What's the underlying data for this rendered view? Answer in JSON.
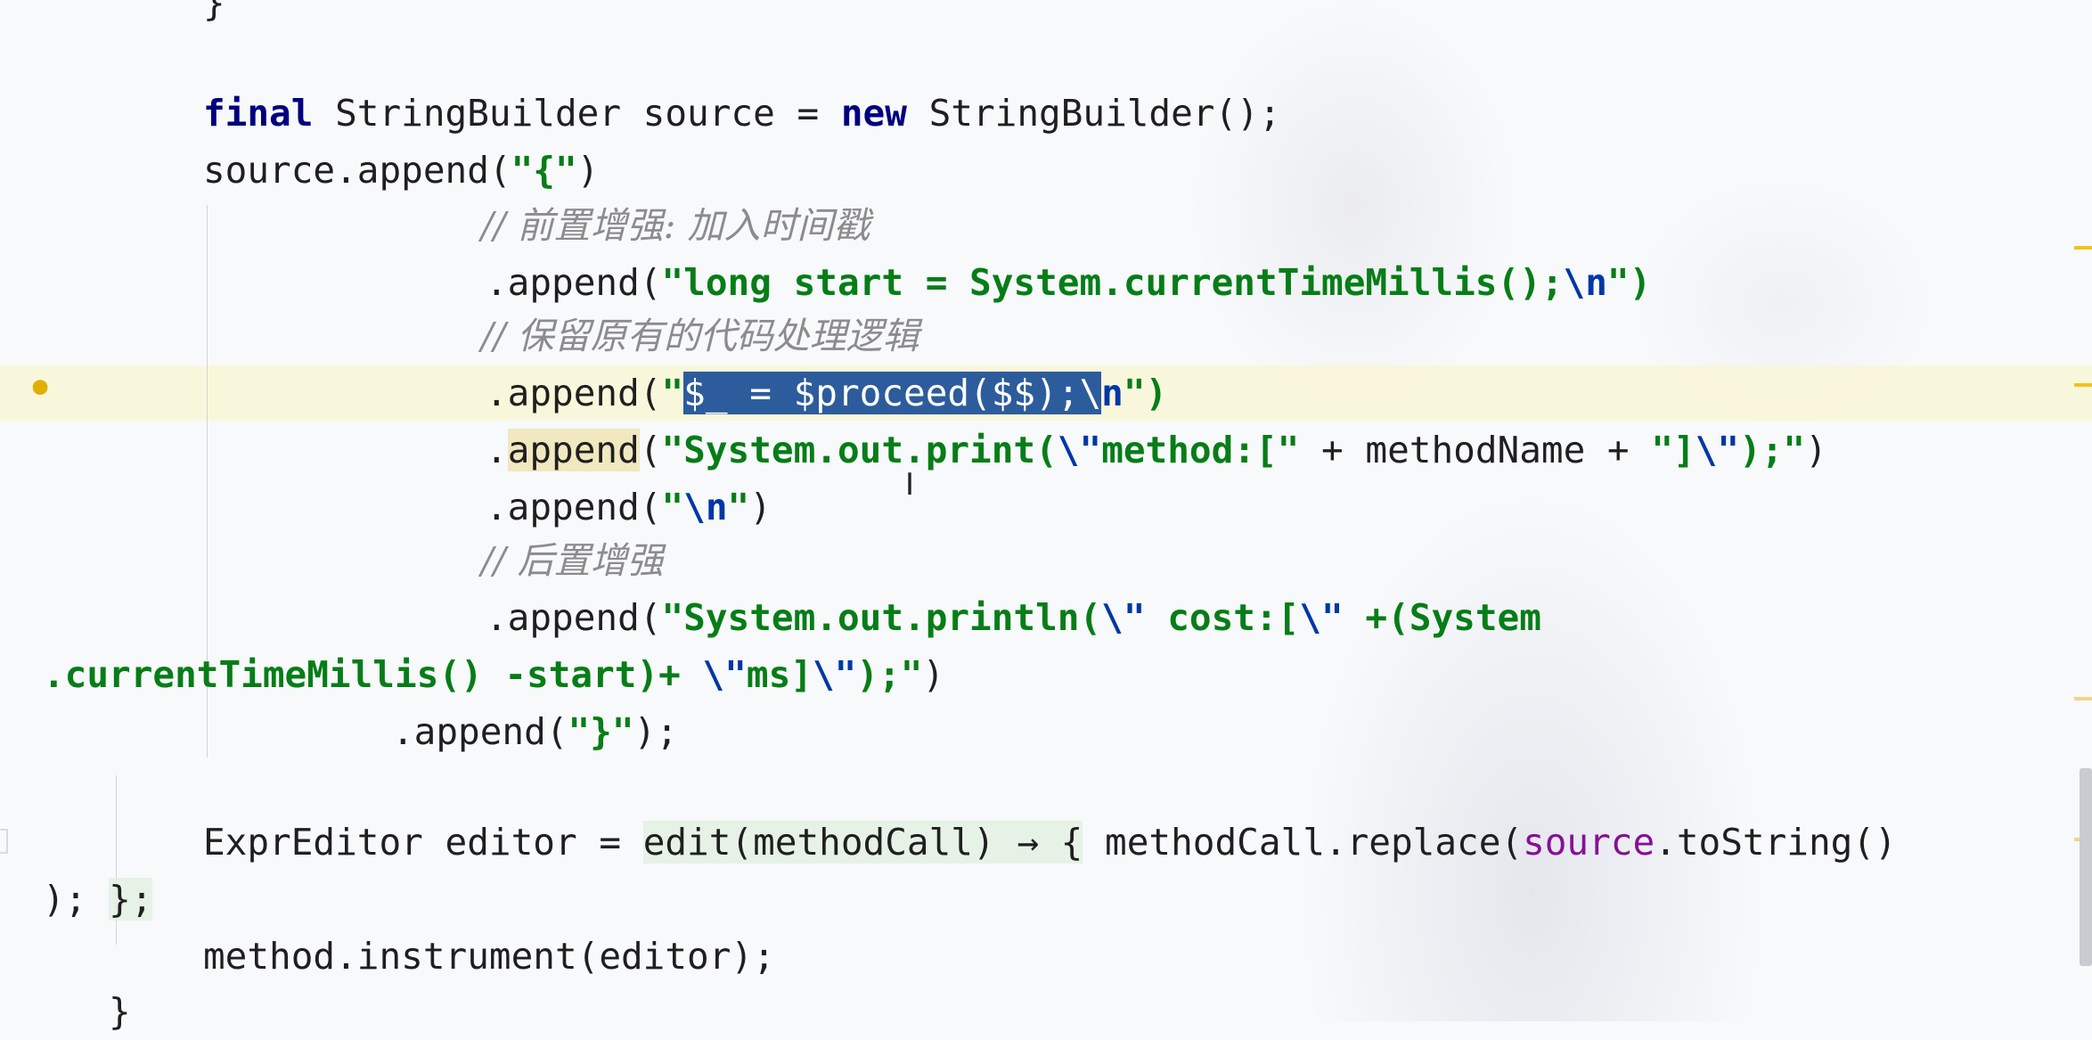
{
  "editor": {
    "lines": {
      "l0": "}",
      "l1_kw1": "final",
      "l1_mid": " StringBuilder source = ",
      "l1_kw2": "new",
      "l1_end": " StringBuilder();",
      "l2_a": "source.append(",
      "l2_str": "\"{\"",
      "l2_b": ")",
      "c1": "// 前置增强: 加入时间戳",
      "l3_a": ".append(",
      "l3_str": "\"long start = System.currentTimeMillis();",
      "l3_esc": "\\n",
      "l3_end": "\")",
      "c2": "// 保留原有的代码处理逻辑",
      "l4_a": ".append(",
      "l4_q": "\"",
      "l4_sel": "$_ = $proceed($$);\\",
      "l4_esc": "n",
      "l4_end": "\")",
      "l5_dot": ".",
      "l5_append": "append",
      "l5_p": "(",
      "l5_str1": "\"System.out.print(",
      "l5_esc1": "\\\"",
      "l5_str2": "method:[\"",
      "l5_mid": " + methodName + ",
      "l5_str3": "\"]",
      "l5_esc2": "\\\"",
      "l5_str4": ");\"",
      "l5_end": ")",
      "l6_a": ".append(",
      "l6_q1": "\"",
      "l6_esc": "\\n",
      "l6_q2": "\"",
      "l6_end": ")",
      "c3": "// 后置增强",
      "l7_a": ".append(",
      "l7_str1": "\"System.out.println(",
      "l7_esc1": "\\\"",
      "l7_str2": " cost:[",
      "l7_esc2": "\\\"",
      "l7_str3": " +(System",
      "l8_str1": ".currentTimeMillis() -start)+ ",
      "l8_esc1": "\\\"",
      "l8_str2": "ms]",
      "l8_esc2": "\\\"",
      "l8_str3": ");\"",
      "l8_end": ")",
      "l9_a": ".append(",
      "l9_str": "\"}\"",
      "l9_end": ");",
      "l10_a": "ExprEditor editor = ",
      "l10_lambda": "edit(methodCall) → {",
      "l10_b": " methodCall.replace(",
      "l10_field": "source",
      "l10_c": ".toString()",
      "l11_a": "); ",
      "l11_b": "};",
      "l12": "method.instrument(editor);",
      "l13": "}"
    }
  },
  "gutter": {
    "intention_icon": "lightbulb-icon"
  },
  "cursor": {
    "icon": "text-cursor-icon",
    "glyph": "I"
  }
}
